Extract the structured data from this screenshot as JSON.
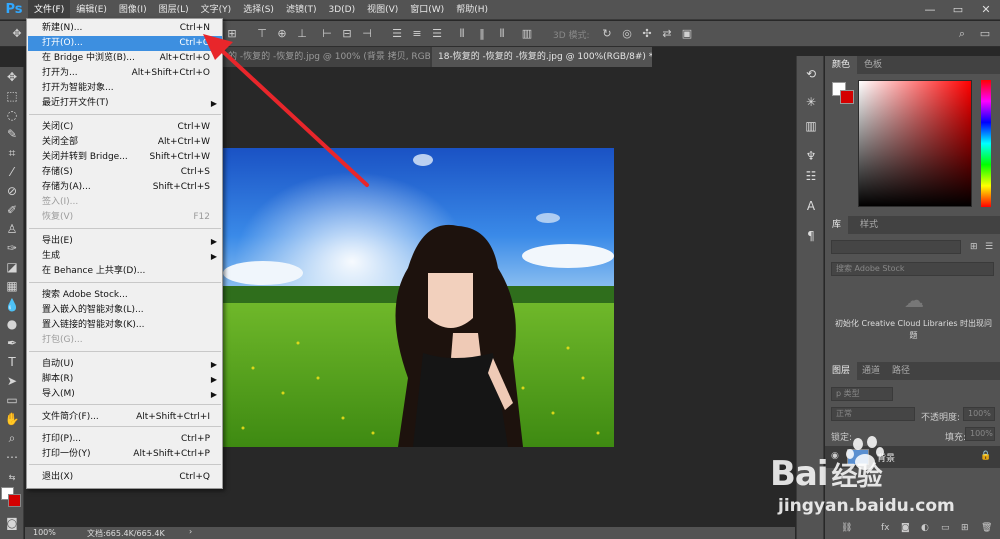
{
  "app": {
    "logo": "Ps"
  },
  "menubar": {
    "items": [
      "文件(F)",
      "编辑(E)",
      "图像(I)",
      "图层(L)",
      "文字(Y)",
      "选择(S)",
      "滤镜(T)",
      "3D(D)",
      "视图(V)",
      "窗口(W)",
      "帮助(H)"
    ],
    "active_index": 0,
    "window_controls": [
      "—",
      "▭",
      "✕"
    ]
  },
  "options": {
    "threed_label": "3D 模式:"
  },
  "tabs": [
    {
      "label": "的 -恢复的 -恢复的.jpg @ 100% (背景 拷贝, RGB/8#) *",
      "close": "×"
    },
    {
      "label": "18-恢复的 -恢复的 -恢复的.jpg @ 100%(RGB/8#) *",
      "close": "×"
    }
  ],
  "file_menu": {
    "items": [
      {
        "label": "新建(N)...",
        "shortcut": "Ctrl+N"
      },
      {
        "label": "打开(O)...",
        "shortcut": "Ctrl+O",
        "highlighted": true
      },
      {
        "label": "在 Bridge 中浏览(B)...",
        "shortcut": "Alt+Ctrl+O"
      },
      {
        "label": "打开为...",
        "shortcut": "Alt+Shift+Ctrl+O"
      },
      {
        "label": "打开为智能对象..."
      },
      {
        "label": "最近打开文件(T)",
        "submenu": true
      },
      {
        "label": "关闭(C)",
        "shortcut": "Ctrl+W"
      },
      {
        "label": "关闭全部",
        "shortcut": "Alt+Ctrl+W"
      },
      {
        "label": "关闭并转到 Bridge...",
        "shortcut": "Shift+Ctrl+W"
      },
      {
        "label": "存储(S)",
        "shortcut": "Ctrl+S"
      },
      {
        "label": "存储为(A)...",
        "shortcut": "Shift+Ctrl+S"
      },
      {
        "label": "签入(I)...",
        "disabled": true
      },
      {
        "label": "恢复(V)",
        "shortcut": "F12",
        "disabled": true
      },
      {
        "label": "导出(E)",
        "submenu": true
      },
      {
        "label": "生成",
        "submenu": true
      },
      {
        "label": "在 Behance 上共享(D)..."
      },
      {
        "label": "搜索 Adobe Stock..."
      },
      {
        "label": "置入嵌入的智能对象(L)..."
      },
      {
        "label": "置入链接的智能对象(K)..."
      },
      {
        "label": "打包(G)...",
        "disabled": true
      },
      {
        "label": "自动(U)",
        "submenu": true
      },
      {
        "label": "脚本(R)",
        "submenu": true
      },
      {
        "label": "导入(M)",
        "submenu": true
      },
      {
        "label": "文件简介(F)...",
        "shortcut": "Alt+Shift+Ctrl+I"
      },
      {
        "label": "打印(P)...",
        "shortcut": "Ctrl+P"
      },
      {
        "label": "打印一份(Y)",
        "shortcut": "Alt+Shift+Ctrl+P"
      },
      {
        "label": "退出(X)",
        "shortcut": "Ctrl+Q"
      }
    ]
  },
  "statusbar": {
    "zoom": "100%",
    "doc": "文档:665.4K/665.4K",
    "arrow": "›"
  },
  "panels": {
    "color_tabs": [
      "颜色",
      "色板"
    ],
    "library_tabs": [
      "库",
      "样式"
    ],
    "library_search": "搜索 Adobe Stock",
    "library_message": "初始化 Creative Cloud Libraries 时出现问题",
    "layers_tabs": [
      "图层",
      "通道",
      "路径"
    ],
    "layer_kind": "p 类型",
    "blend_mode": "正常",
    "opacity_label": "不透明度:",
    "opacity_value": "100%",
    "lock_label": "锁定:",
    "fill_label": "填充:",
    "fill_value": "100%",
    "layer_name": "背景",
    "footer_icons": [
      "链接",
      "fx",
      "蒙版",
      "调整",
      "组",
      "新建",
      "删除"
    ]
  },
  "watermark": {
    "brand": "Bai",
    "brand2": "经验",
    "url": "jingyan.baidu.com"
  },
  "colors": {
    "accent": "#3d8fe0",
    "annotation_arrow": "#e8262b",
    "fg": "#ffffff",
    "bg": "#d40000"
  }
}
